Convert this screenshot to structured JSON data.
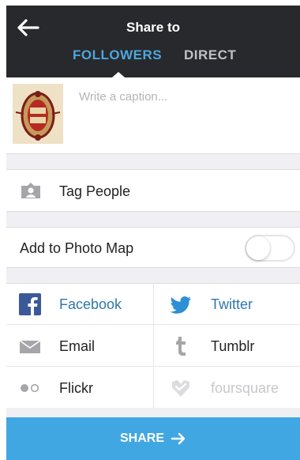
{
  "header": {
    "title": "Share to",
    "tabs": [
      {
        "label": "FOLLOWERS",
        "active": true
      },
      {
        "label": "DIRECT",
        "active": false
      }
    ]
  },
  "caption": {
    "placeholder": "Write a caption...",
    "value": ""
  },
  "tag_people": {
    "label": "Tag People"
  },
  "photo_map": {
    "label": "Add to Photo Map",
    "enabled": false
  },
  "share_targets": [
    {
      "label": "Facebook",
      "icon": "facebook-icon",
      "active": true
    },
    {
      "label": "Twitter",
      "icon": "twitter-icon",
      "active": true
    },
    {
      "label": "Email",
      "icon": "email-icon",
      "active": false
    },
    {
      "label": "Tumblr",
      "icon": "tumblr-icon",
      "active": false
    },
    {
      "label": "Flickr",
      "icon": "flickr-icon",
      "active": false
    },
    {
      "label": "foursquare",
      "icon": "foursquare-icon",
      "active": false
    }
  ],
  "share_button": {
    "label": "SHARE"
  },
  "colors": {
    "header_bg": "#27292c",
    "accent": "#41a7e2",
    "active_text": "#2f78ad",
    "facebook": "#3b5998",
    "twitter": "#2d8fd5",
    "inactive_icon": "#a6a6aa",
    "disabled_text": "#c8c8cc"
  }
}
